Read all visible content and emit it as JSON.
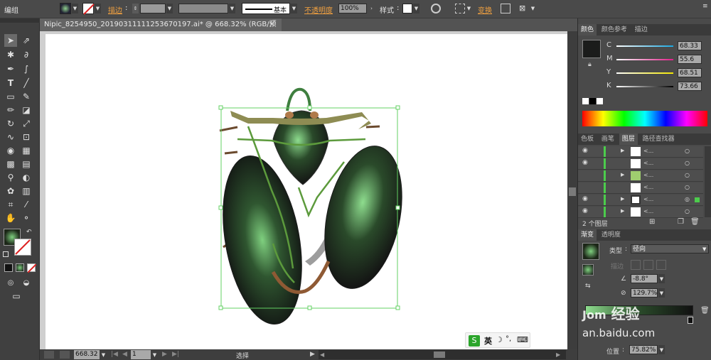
{
  "control_bar": {
    "mode": "编组",
    "stroke_label": "描边",
    "stroke_style": "基本",
    "opacity_label": "不透明度",
    "opacity_value": "100%",
    "style_label": "样式",
    "transform_label": "变换"
  },
  "document": {
    "tab_title": "Nipic_8254950_20190311111253670197.ai* @ 668.32% (RGB/预览)",
    "close": "×"
  },
  "status_bar": {
    "zoom": "668.32",
    "artboard": "1",
    "tool": "选择"
  },
  "ime": {
    "lang": "英",
    "moon": "☽",
    "punct": "°,"
  },
  "color_panel": {
    "tabs": [
      "颜色",
      "颜色参考",
      "描边"
    ],
    "channels": [
      {
        "name": "C",
        "value": "68.33"
      },
      {
        "name": "M",
        "value": "55.6"
      },
      {
        "name": "Y",
        "value": "68.51"
      },
      {
        "name": "K",
        "value": "73.66"
      }
    ]
  },
  "layers_panel": {
    "tabs": [
      "色板",
      "画笔",
      "图层",
      "路径查找器"
    ],
    "count_label": "2 个图层",
    "rows": 6
  },
  "gradient_panel": {
    "tabs": [
      "渐变",
      "透明度"
    ],
    "type_label": "类型",
    "type_value": "径向",
    "stroke_label": "描边",
    "angle_value": "-8.8°",
    "ratio_value": "129.7%",
    "location_label": "位置",
    "location_value": "75.82%"
  },
  "watermark": {
    "brand": "经验",
    "domain": "an.baidu.com"
  },
  "colors": {
    "accent_orange": "#f0a040",
    "layer_green": "#4ccc4c"
  }
}
